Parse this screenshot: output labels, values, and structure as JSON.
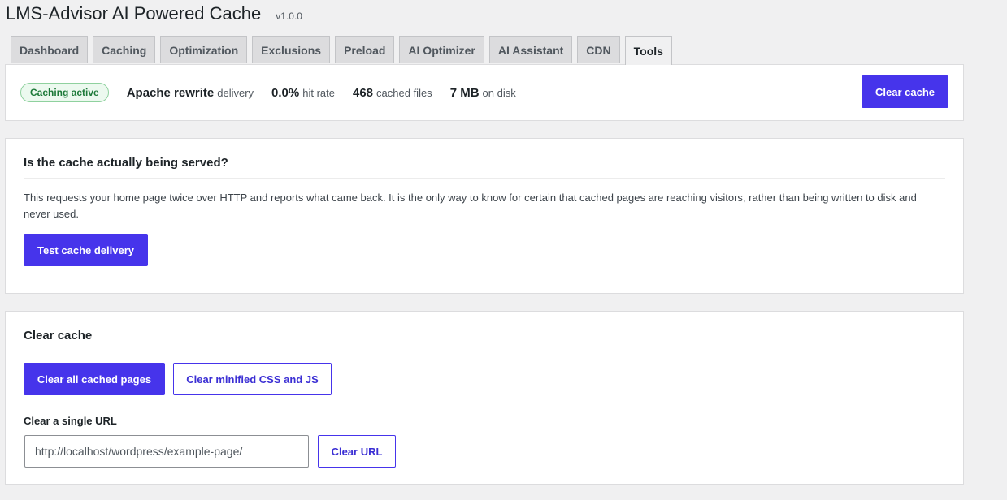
{
  "header": {
    "title": "LMS-Advisor AI Powered Cache",
    "version": "v1.0.0"
  },
  "tabs": [
    {
      "label": "Dashboard",
      "active": false
    },
    {
      "label": "Caching",
      "active": false
    },
    {
      "label": "Optimization",
      "active": false
    },
    {
      "label": "Exclusions",
      "active": false
    },
    {
      "label": "Preload",
      "active": false
    },
    {
      "label": "AI Optimizer",
      "active": false
    },
    {
      "label": "AI Assistant",
      "active": false
    },
    {
      "label": "CDN",
      "active": false
    },
    {
      "label": "Tools",
      "active": true
    }
  ],
  "status": {
    "badge": "Caching active",
    "delivery_value": "Apache rewrite",
    "delivery_label": "delivery",
    "hit_rate_value": "0.0%",
    "hit_rate_label": "hit rate",
    "cached_files_value": "468",
    "cached_files_label": "cached files",
    "disk_value": "7 MB",
    "disk_label": "on disk",
    "clear_button": "Clear cache"
  },
  "delivery_test": {
    "heading": "Is the cache actually being served?",
    "description": "This requests your home page twice over HTTP and reports what came back. It is the only way to know for certain that cached pages are reaching visitors, rather than being written to disk and never used.",
    "button": "Test cache delivery"
  },
  "clear_section": {
    "heading": "Clear cache",
    "clear_all_button": "Clear all cached pages",
    "clear_minified_button": "Clear minified CSS and JS",
    "single_url_label": "Clear a single URL",
    "url_value": "http://localhost/wordpress/example-page/",
    "clear_url_button": "Clear URL"
  },
  "colors": {
    "accent": "#4634eb",
    "badge_green": "#1e7a3a",
    "background": "#f0f0f1"
  }
}
